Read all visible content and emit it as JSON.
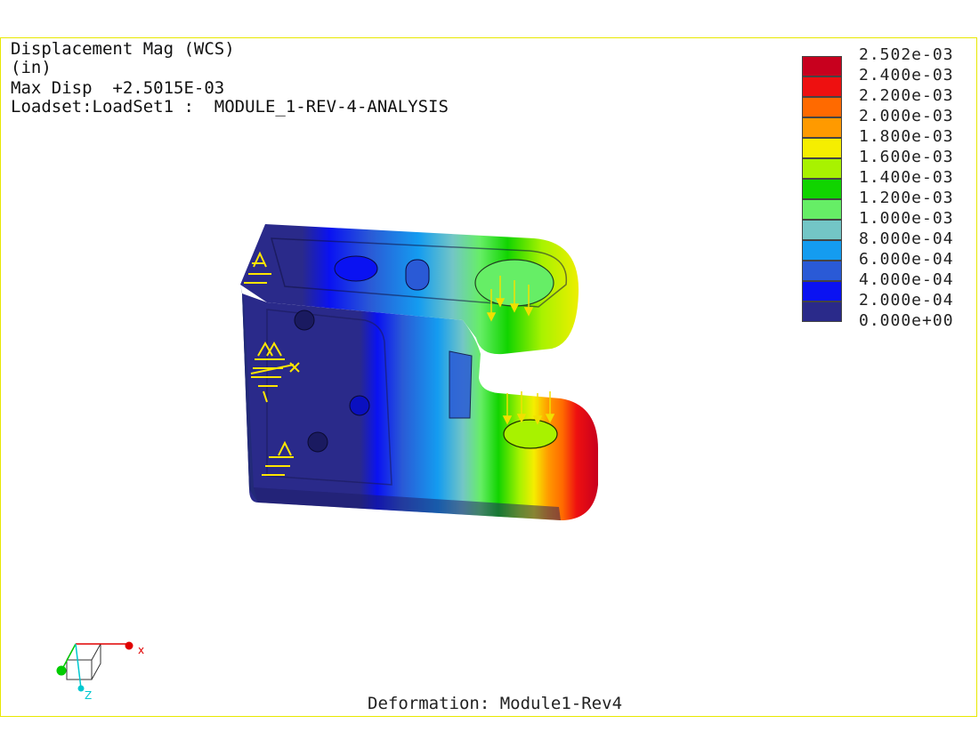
{
  "header": {
    "line1": "Displacement Mag (WCS)",
    "line2": "(in)",
    "max_disp_label": "Max Disp",
    "max_disp_value": "+2.5015E-03",
    "loadset_label": "Loadset:LoadSet1 :",
    "loadset_value": "MODULE_1-REV-4-ANALYSIS"
  },
  "legend": {
    "entries": [
      {
        "value": "2.502e-03",
        "color": "#c8001e"
      },
      {
        "value": "2.400e-03",
        "color": "#ee1010"
      },
      {
        "value": "2.200e-03",
        "color": "#ff6a00"
      },
      {
        "value": "2.000e-03",
        "color": "#ff9a00"
      },
      {
        "value": "1.800e-03",
        "color": "#f5ee00"
      },
      {
        "value": "1.600e-03",
        "color": "#a8f200"
      },
      {
        "value": "1.400e-03",
        "color": "#11d400"
      },
      {
        "value": "1.200e-03",
        "color": "#66ee66"
      },
      {
        "value": "1.000e-03",
        "color": "#73c6c6"
      },
      {
        "value": "8.000e-04",
        "color": "#149cf0"
      },
      {
        "value": "6.000e-04",
        "color": "#2a5ad6"
      },
      {
        "value": "4.000e-04",
        "color": "#0a12f2"
      },
      {
        "value": "2.000e-04",
        "color": "#2a2a8a"
      }
    ],
    "last_label": "0.000e+00"
  },
  "footer": {
    "deformation_label": "Deformation:",
    "deformation_value": "Module1-Rev4"
  },
  "triad": {
    "x_label": "x",
    "z_label": "Z",
    "colors": {
      "x": "#e00000",
      "y": "#00cc00",
      "z": "#00c8d0"
    }
  },
  "colors": {
    "border": "#e8e800",
    "constraint": "#ffe600",
    "load_arrow": "#f0e000"
  }
}
